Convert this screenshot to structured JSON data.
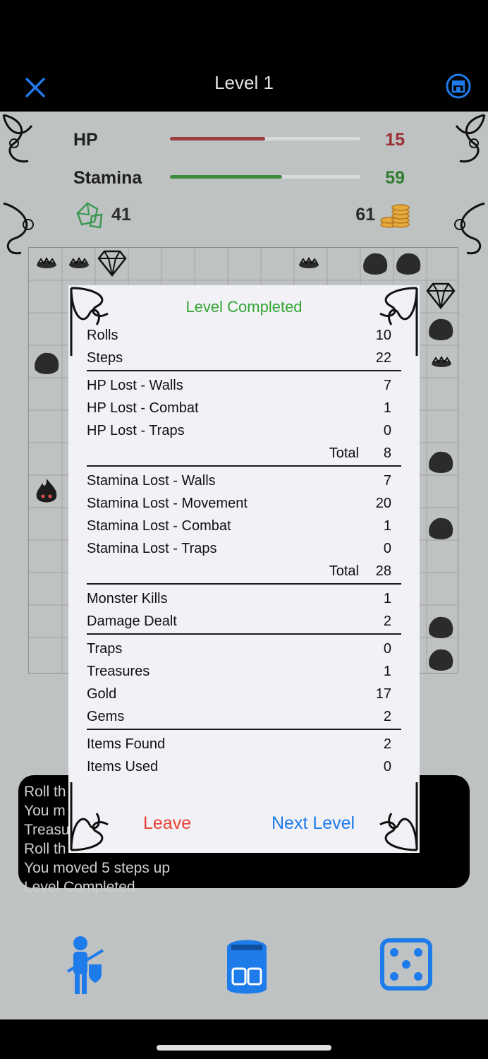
{
  "nav": {
    "title": "Level 1"
  },
  "stats": {
    "hp": {
      "label": "HP",
      "value": "15",
      "fraction": 0.5,
      "color": "#9b3c3f"
    },
    "stamina": {
      "label": "Stamina",
      "value": "59",
      "fraction": 0.59,
      "color": "#3d8b3d"
    },
    "gems": "41",
    "gold": "61"
  },
  "log": {
    "lines": [
      "Roll th",
      "You m",
      "Treasu",
      "Roll th",
      "You moved 5 steps up",
      "Level Completed"
    ]
  },
  "dialog": {
    "title": "Level Completed",
    "groups": [
      [
        {
          "label": "Rolls",
          "value": "10"
        },
        {
          "label": "Steps",
          "value": "22"
        }
      ],
      [
        {
          "label": "HP Lost - Walls",
          "value": "7"
        },
        {
          "label": "HP Lost - Combat",
          "value": "1"
        },
        {
          "label": "HP Lost - Traps",
          "value": "0"
        },
        {
          "label": "Total",
          "value": "8",
          "total": true
        }
      ],
      [
        {
          "label": "Stamina Lost - Walls",
          "value": "7"
        },
        {
          "label": "Stamina Lost - Movement",
          "value": "20"
        },
        {
          "label": "Stamina Lost - Combat",
          "value": "1"
        },
        {
          "label": "Stamina Lost - Traps",
          "value": "0"
        },
        {
          "label": "Total",
          "value": "28",
          "total": true
        }
      ],
      [
        {
          "label": "Monster Kills",
          "value": "1"
        },
        {
          "label": "Damage Dealt",
          "value": "2"
        }
      ],
      [
        {
          "label": "Traps",
          "value": "0"
        },
        {
          "label": "Treasures",
          "value": "1"
        },
        {
          "label": "Gold",
          "value": "17"
        },
        {
          "label": "Gems",
          "value": "2"
        }
      ],
      [
        {
          "label": "Items Found",
          "value": "2"
        },
        {
          "label": "Items Used",
          "value": "0"
        }
      ]
    ],
    "leave_label": "Leave",
    "next_label": "Next Level"
  },
  "tabs": [
    {
      "name": "hero",
      "icon": "knight-icon"
    },
    {
      "name": "inventory",
      "icon": "backpack-icon"
    },
    {
      "name": "roll",
      "icon": "dice-icon"
    }
  ],
  "colors": {
    "accent": "#1e7bea",
    "success": "#33a634",
    "danger": "#ea4135"
  }
}
